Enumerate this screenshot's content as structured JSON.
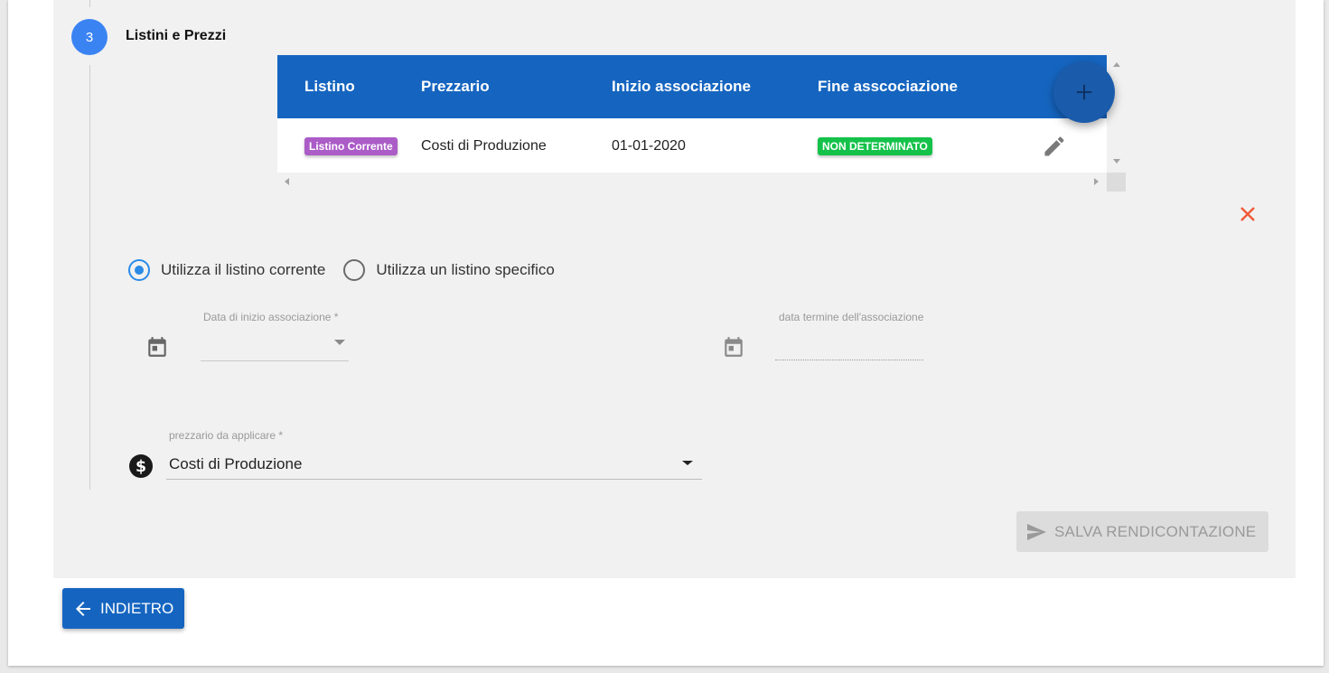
{
  "step": {
    "number": "3",
    "title": "Listini e Prezzi"
  },
  "table": {
    "headers": [
      "Listino",
      "Prezzario",
      "Inizio associazione",
      "Fine asscociazione"
    ],
    "rows": [
      {
        "listino_badge": "Listino Corrente",
        "prezzario": "Costi di Produzione",
        "inizio": "01-01-2020",
        "fine_badge": "NON DETERMINATO"
      }
    ],
    "add_icon": "plus-icon",
    "edit_icon": "pencil-icon"
  },
  "close_icon": "close-icon",
  "radio": {
    "options": [
      "Utilizza il listino corrente",
      "Utilizza un listino specifico"
    ],
    "selected_index": 0
  },
  "form": {
    "start_date": {
      "label": "Data di inizio associazione *",
      "value": ""
    },
    "end_date": {
      "label": "data termine dell'associazione",
      "value": ""
    },
    "prezzario": {
      "label": "prezzario da applicare *",
      "value": "Costi di Produzione"
    }
  },
  "buttons": {
    "save_label": "SALVA RENDICONTAZIONE",
    "back_label": "INDIETRO"
  },
  "colors": {
    "primary": "#1565c0",
    "step": "#3a83f3",
    "badge_purple": "#ab5cc7",
    "badge_green": "#14c24a",
    "radio_selected": "#2b8ae6",
    "close": "#f05a38"
  }
}
